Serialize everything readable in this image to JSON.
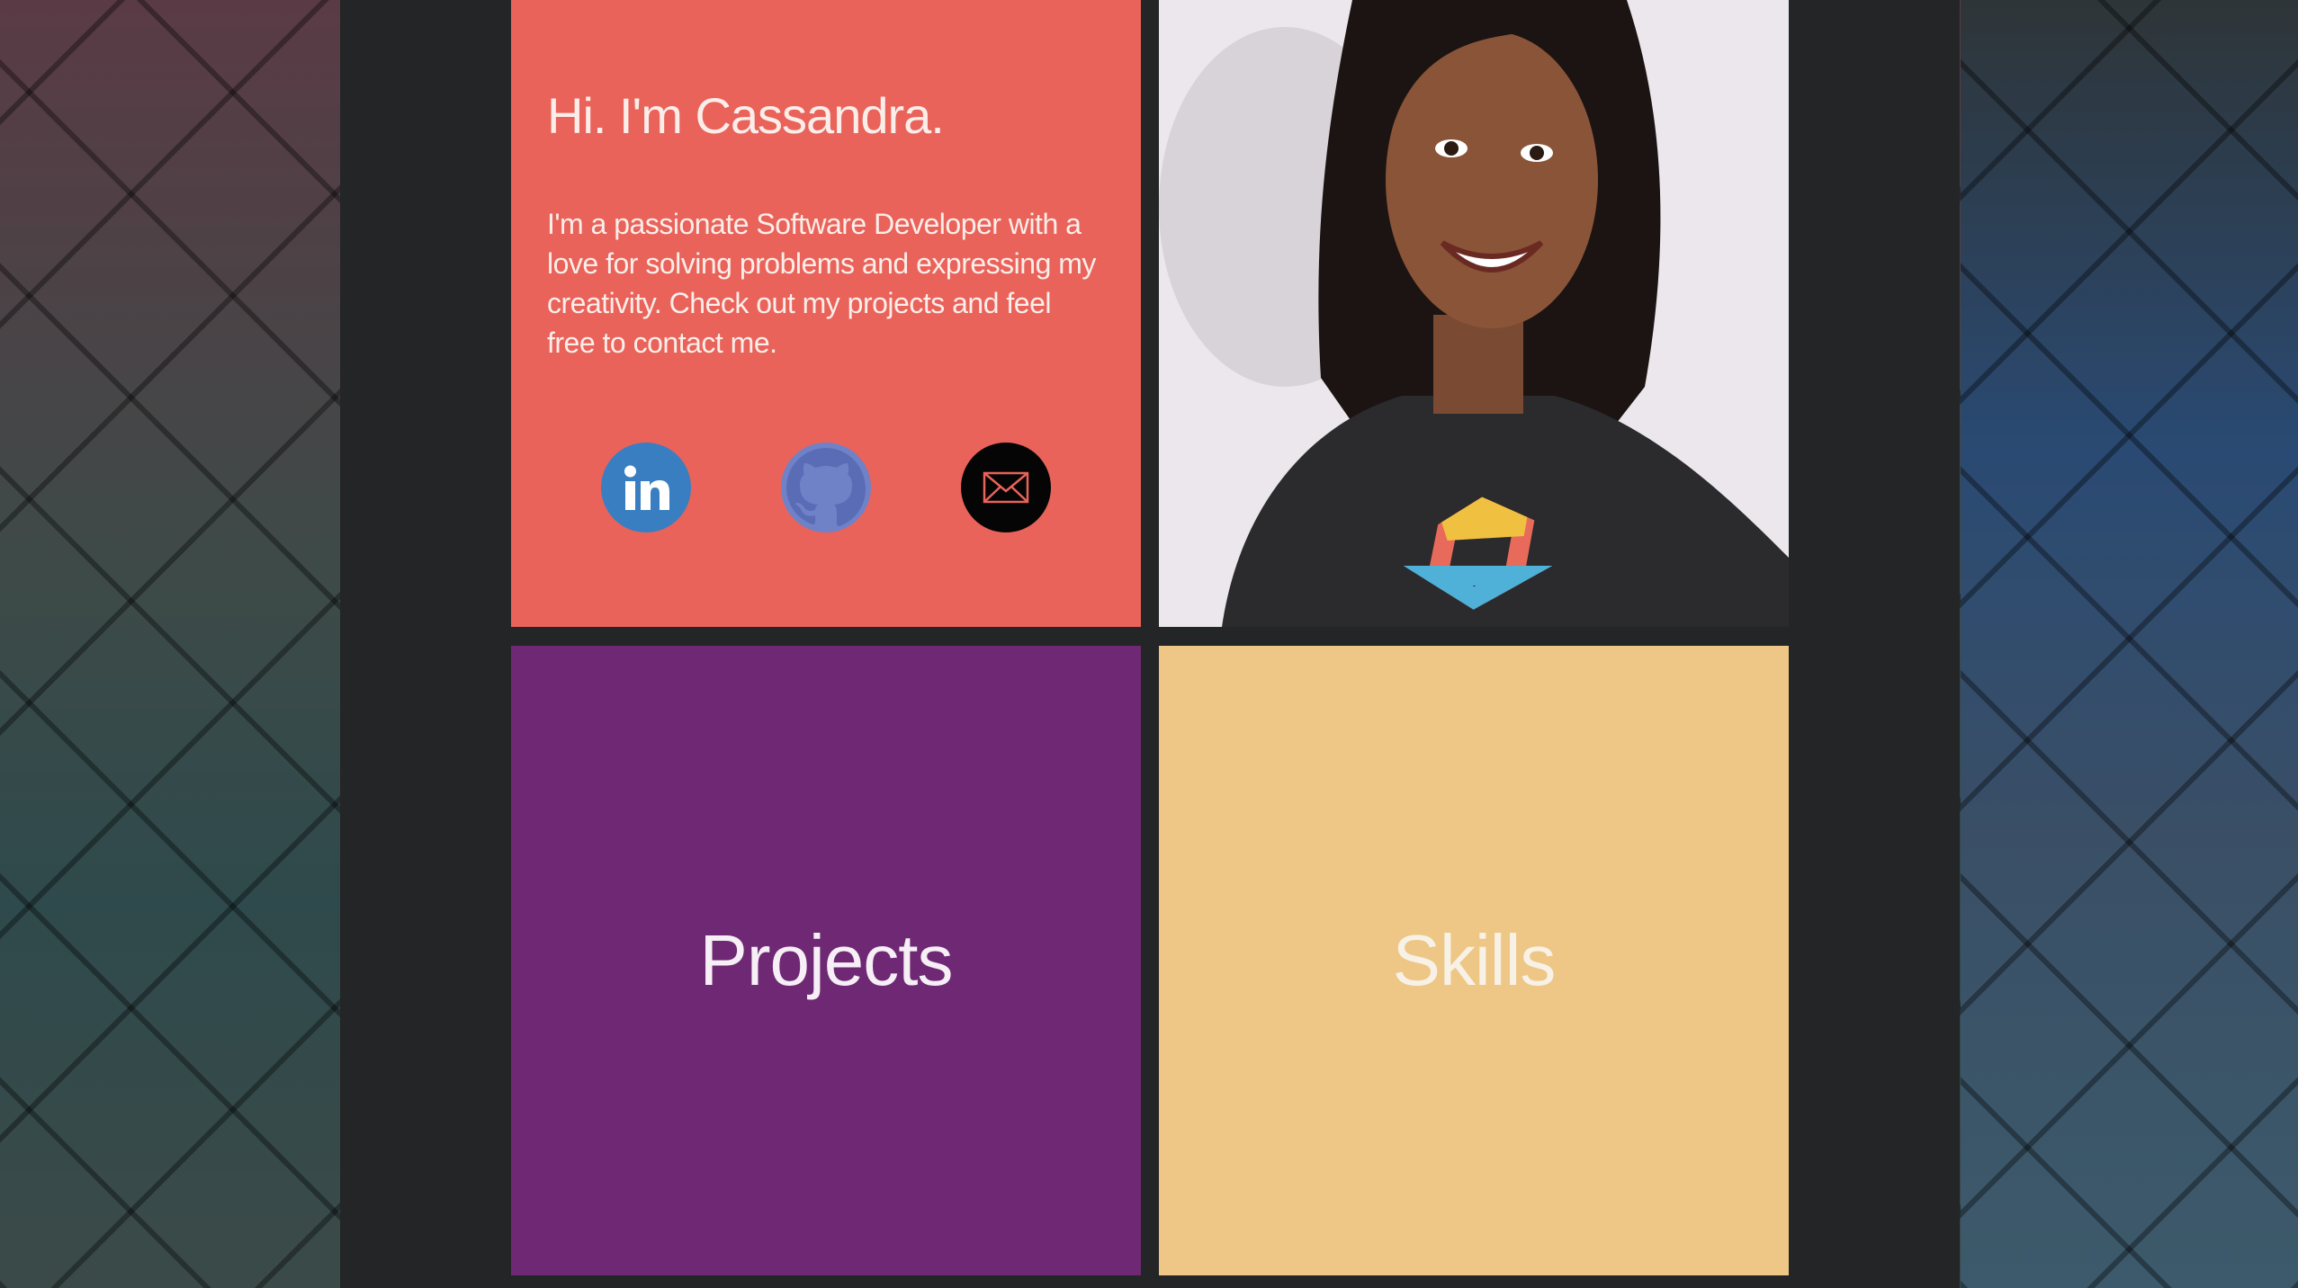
{
  "intro": {
    "title": "Hi. I'm Cassandra.",
    "text": "I'm a passionate Software Developer with a love for solving problems and expressing my creativity. Check out my projects and feel free to contact me."
  },
  "social": [
    {
      "name": "LinkedIn",
      "icon": "linkedin-icon",
      "color": "#3a7ec2"
    },
    {
      "name": "GitHub",
      "icon": "github-icon",
      "color": "#6f82c8"
    },
    {
      "name": "Email",
      "icon": "envelope-icon",
      "color": "#050505"
    }
  ],
  "tiles": {
    "projects": "Projects",
    "skills": "Skills"
  },
  "colors": {
    "intro_bg": "#e9635a",
    "projects_bg": "#6f2873",
    "skills_bg": "#eec685",
    "page_bg": "#242526"
  }
}
